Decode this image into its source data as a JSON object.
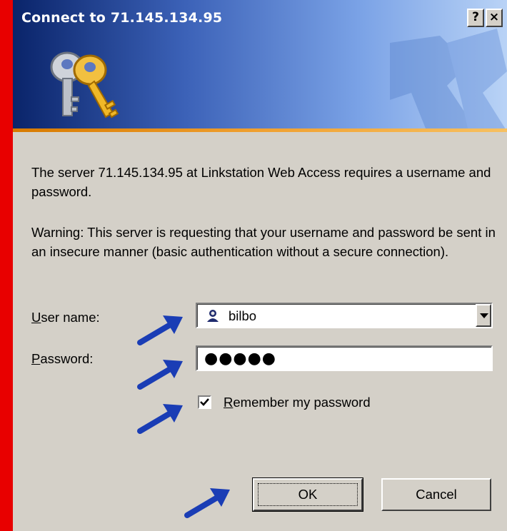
{
  "dialog": {
    "title": "Connect to 71.145.134.95",
    "help_button": "?",
    "close_button": "×"
  },
  "message": {
    "line1": "The server 71.145.134.95 at Linkstation Web Access requires a username and password.",
    "line2": "Warning: This server is requesting that your username and password be sent in an insecure manner (basic authentication without a secure connection)."
  },
  "form": {
    "username_label_key": "U",
    "username_label_rest": "ser name:",
    "username_value": "bilbo",
    "password_label_key": "P",
    "password_label_rest": "assword:",
    "password_value": "●●●●●",
    "remember_label_key": "R",
    "remember_label_rest": "emember my password",
    "remember_checked": true
  },
  "buttons": {
    "ok": "OK",
    "cancel": "Cancel"
  },
  "colors": {
    "background": "#e80000",
    "title_bar": "#0a246a",
    "dialog_face": "#d4d0c8",
    "arrow": "#1a3db5"
  },
  "icons": [
    "keys-icon",
    "user-icon",
    "dropdown-arrow-icon",
    "checkmark-icon",
    "arrow-pointer-icon"
  ]
}
